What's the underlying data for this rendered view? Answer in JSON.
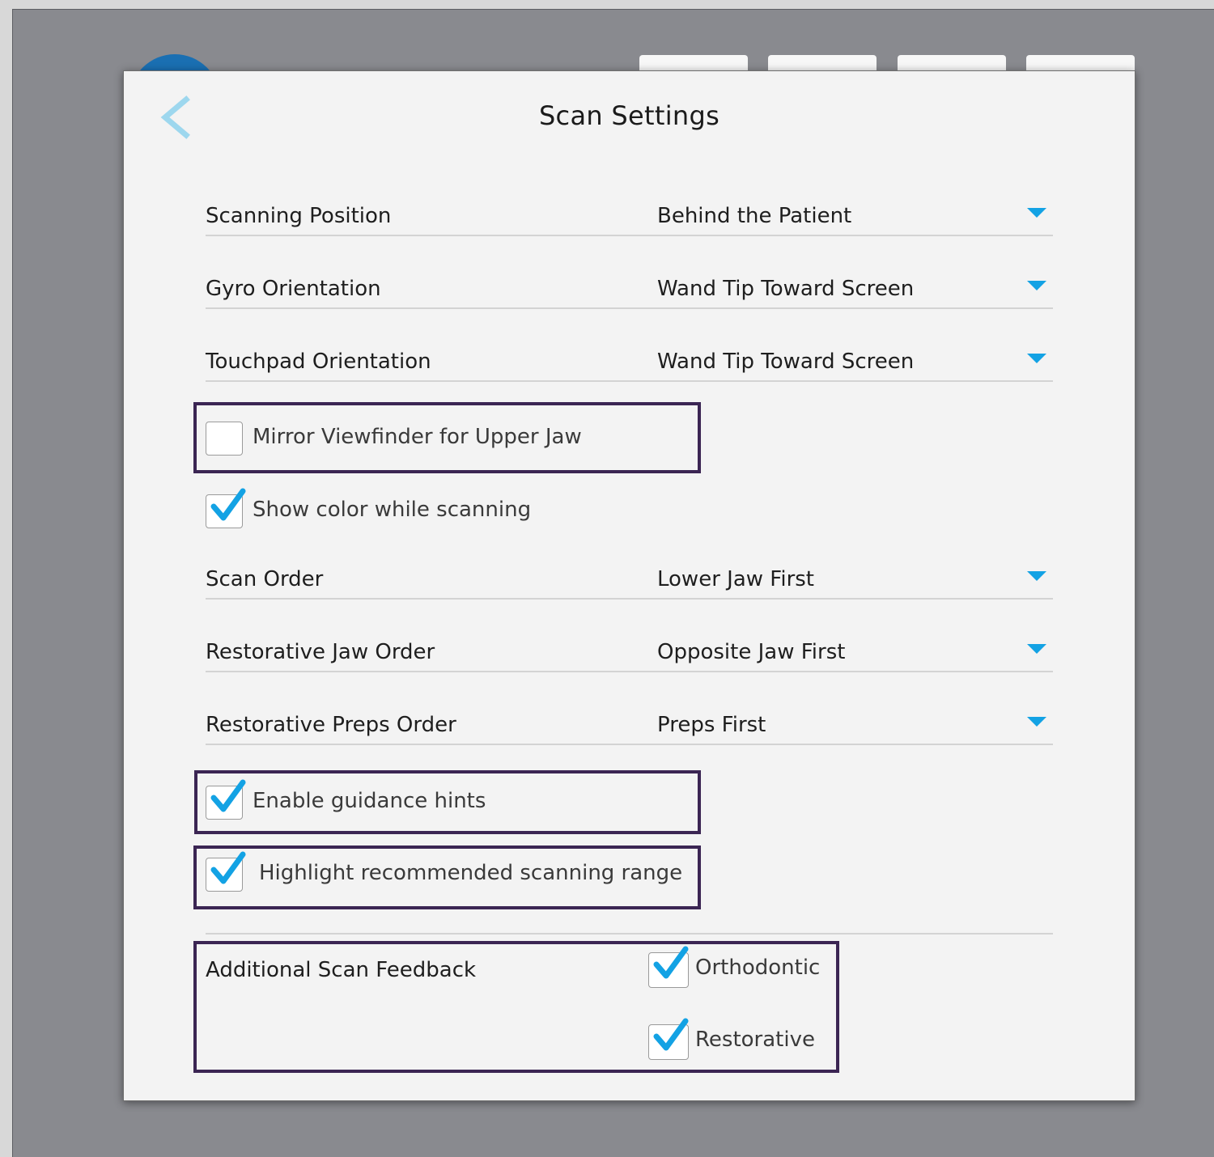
{
  "title": "Scan Settings",
  "icons": {
    "back": "chevron-left-icon",
    "dropdown": "caret-down-icon",
    "check": "checkmark-icon"
  },
  "colors": {
    "accent": "#13a2e4",
    "highlight_box": "#3b2553",
    "backdrop": "#898a8f"
  },
  "settings": [
    {
      "label": "Scanning Position",
      "value": "Behind the Patient"
    },
    {
      "label": "Gyro Orientation",
      "value": "Wand Tip Toward Screen"
    },
    {
      "label": "Touchpad Orientation",
      "value": "Wand Tip Toward Screen"
    },
    {
      "label": "Scan Order",
      "value": "Lower Jaw First"
    },
    {
      "label": "Restorative Jaw Order",
      "value": "Opposite Jaw First"
    },
    {
      "label": "Restorative Preps Order",
      "value": "Preps First"
    }
  ],
  "checkboxes": {
    "mirror_viewfinder": {
      "label": "Mirror Viewfinder for Upper Jaw",
      "checked": false
    },
    "show_color": {
      "label": "Show color while scanning",
      "checked": true
    },
    "guidance_hints": {
      "label": "Enable guidance hints",
      "checked": true
    },
    "highlight_range": {
      "label": "Highlight recommended scanning range",
      "checked": true
    }
  },
  "additional_feedback": {
    "label": "Additional Scan Feedback",
    "options": [
      {
        "label": "Orthodontic",
        "checked": true
      },
      {
        "label": "Restorative",
        "checked": true
      }
    ]
  }
}
